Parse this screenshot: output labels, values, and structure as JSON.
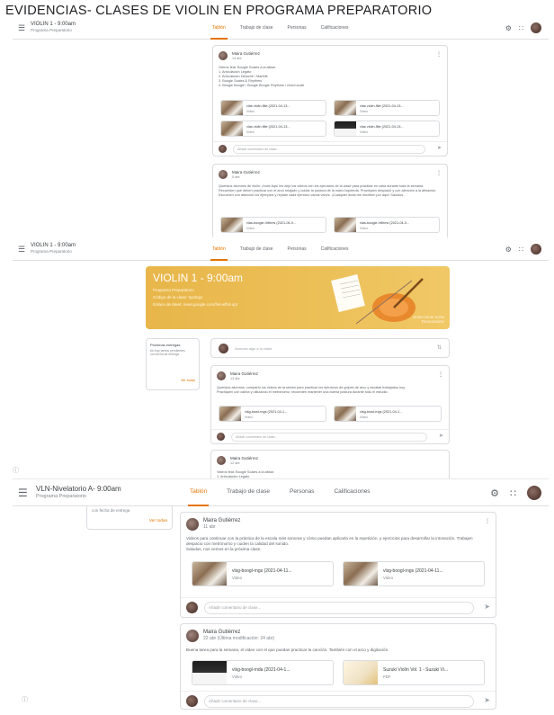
{
  "doc_title": "EVIDENCIAS- CLASES DE VIOLIN  EN PROGRAMA PREPARATORIO",
  "shots": [
    {
      "class_title": "VIOLIN 1 - 9:00am",
      "class_subtitle": "Programa Preparatorio",
      "tabs": [
        "Tablón",
        "Trabajo de clase",
        "Personas",
        "Calificaciones"
      ],
      "post1": {
        "author": "Maira Gutiérrez",
        "date": "13 abr",
        "text": "Videos feat. Boogie Scales a la alfaar.\n1. Articulación Legato\n2. Articulación Detaché / Martelé\n3. Boogie Scales & Rhythms\n4. Boogie Boogie / Boogie Boogie Rhythms / chord scale",
        "attachments": [
          {
            "title": "vlas violin-filte (2021-04-13...",
            "type": "Vídeo"
          },
          {
            "title": "vlas violin-filte (2021-04-13...",
            "type": "Vídeo"
          },
          {
            "title": "vlas violin-filte (2021-04-13...",
            "type": "Vídeo"
          },
          {
            "title": "vlas violin-filte (2021-04-13...",
            "type": "Vídeo"
          }
        ],
        "comment_placeholder": "Añadir comentario de clase..."
      },
      "post2": {
        "author": "Maira Gutiérrez",
        "date": "5 abr",
        "text": "Queridos alumnos de violín: ¡hola! Aquí les dejo los videos con los ejercicios de la clase para practicar en casa durante toda la semana.\nRecuerden que deben practicar con el arco relajado y cuidar la postura de la mano izquierda. Practiquen despacio y con atención a la afinación.\nEscuchen con atención los ejemplos y repitan cada ejercicio varias veces. ¡Cualquier duda me escriben por aquí! Saludos.",
        "attachments": [
          {
            "title": "vlas-boogie-rhthms (2021-04-0...",
            "type": "Vídeo"
          },
          {
            "title": "vlas-boogie-rhthms (2021-04-0...",
            "type": "Vídeo"
          }
        ]
      }
    },
    {
      "class_title": "VIOLIN 1 - 9:00am",
      "class_subtitle": "Programa Preparatorio",
      "tabs": [
        "Tablón",
        "Trabajo de clase",
        "Personas",
        "Calificaciones"
      ],
      "banner": {
        "title": "VIOLIN 1 - 9:00am",
        "line1": "Programa Preparatorio",
        "line2": "Código de la clase: 5yahqyr",
        "line3": "Enlace de Meet: meet.google.com/fvk-wfbd-upt",
        "link": "Seleccionar tema\nPersonalizar"
      },
      "upcoming": {
        "title": "Próximas entregas",
        "text": "No hay tareas pendientes\ncon fecha de entrega",
        "link": "Ver todas"
      },
      "announce_placeholder": "Anuncia algo a tu clase",
      "post1": {
        "author": "Maira Gutiérrez",
        "date": "13 abr",
        "text": "Queridos alumnos: compárto los videos de la sesión para practicar los ejercicios de golpes de arco y escalas trabajados hoy.\nPractiquen con calma y utilizando el metrónomo; recuerden mantener una buena postura durante todo el estudio.",
        "attachments": [
          {
            "title": "vlsg-bwst-rngs (2021-04-1...",
            "type": "Vídeo"
          },
          {
            "title": "vlsg-bwst-rngs (2021-04-1...",
            "type": "Vídeo"
          }
        ],
        "comment_placeholder": "Añadir comentario de clase..."
      },
      "post2": {
        "author": "Maira Gutiérrez",
        "date": "12 abr",
        "text": "Videos feat. Boogie Scales a la alfaar.\n1. Articulación Legato"
      }
    },
    {
      "class_title": "VLN-Nivelatorio A- 9:00am",
      "class_subtitle": "Programa Preparatorio",
      "tabs": [
        "Tablón",
        "Trabajo de clase",
        "Personas",
        "Calificaciones"
      ],
      "left_upcoming": {
        "text": "con fecha de entrega",
        "link": "Ver todas"
      },
      "post1": {
        "author": "Maira Gutiérrez",
        "date": "11 abr",
        "text": "Videos para continuar con la práctica de la escala más sonoras y cómo puedan aplicarla en la repetición, y ejercicios para desarrollar la intonación. Trabajen despacio con metrónomo y cuiden la calidad del sonido.\nSaludos, nos vemos en la próxima clase.",
        "attachments": [
          {
            "title": "vlsg-boogl-rngs (2021-04-11...",
            "type": "Vídeo"
          },
          {
            "title": "vlsg-boogl-rngs (2021-04-11...",
            "type": "Vídeo"
          }
        ],
        "comment_placeholder": "Añadir comentario de clase..."
      },
      "post2": {
        "author": "Maira Gutiérrez",
        "date": "22 abr (Última modificación: 24 abr)",
        "text": "Buena tarea para la semana, el video con el que puedan practicar la canción. También con el arco y digitación.",
        "attachments": [
          {
            "title": "vlsg-boogl-rnda (2021-04-1...",
            "type": "Vídeo"
          },
          {
            "title": "Suzuki Violín Vol. 1 - Suzuki Vi...",
            "type": "PDF"
          }
        ],
        "comment_placeholder": "Añadir comentario de clase..."
      }
    }
  ],
  "icons": {
    "menu": "hamburger-icon",
    "apps": "apps-icon",
    "settings": "gear-icon",
    "more": "kebab-icon",
    "send": "send-icon"
  },
  "colors": {
    "accent": "#e37400",
    "banner": "#ecbf57"
  }
}
